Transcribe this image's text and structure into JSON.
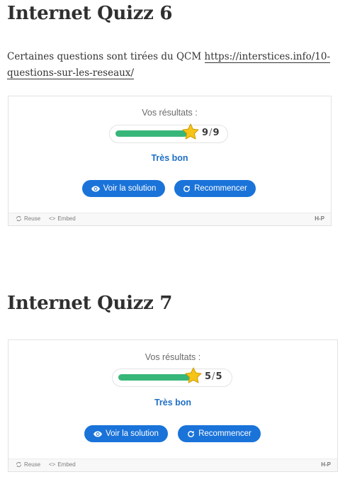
{
  "quizzes": [
    {
      "title": "Internet Quizz 6",
      "intro_text": "Certaines questions sont tirées du QCM ",
      "intro_link": "https://interstices.info/10-questions-sur-les-reseaux/",
      "result_label": "Vos résultats :",
      "score": 9,
      "max_score": 9,
      "progress": 1.0,
      "verdict": "Très bon",
      "solution_button": "Voir la solution",
      "retry_button": "Recommencer",
      "footer": {
        "reuse": "Reuse",
        "embed": "Embed",
        "logo": "H-P"
      }
    },
    {
      "title": "Internet Quizz 7",
      "result_label": "Vos résultats :",
      "score": 5,
      "max_score": 5,
      "progress": 1.0,
      "verdict": "Très bon",
      "solution_button": "Voir la solution",
      "retry_button": "Recommencer",
      "footer": {
        "reuse": "Reuse",
        "embed": "Embed",
        "logo": "H-P"
      }
    }
  ],
  "colors": {
    "accent": "#1a73d9",
    "progress": "#37b679",
    "star": "#f6c317",
    "verdict": "#1f6fc4"
  },
  "icons": {
    "solution": "eye-icon",
    "retry": "refresh-icon",
    "reuse": "recycle-icon",
    "embed": "code-icon",
    "score": "star-icon"
  }
}
